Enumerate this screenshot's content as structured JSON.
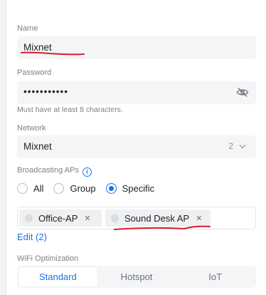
{
  "name": {
    "label": "Name",
    "value": "Mixnet"
  },
  "password": {
    "label": "Password",
    "value": "•••••••••••",
    "help": "Must have at least 8 characters."
  },
  "network": {
    "label": "Network",
    "value": "Mixnet",
    "count": "2"
  },
  "broadcasting": {
    "label": "Broadcasting APs",
    "options": [
      {
        "label": "All",
        "selected": false
      },
      {
        "label": "Group",
        "selected": false
      },
      {
        "label": "Specific",
        "selected": true
      }
    ],
    "chips": [
      "Office-AP",
      "Sound Desk AP"
    ],
    "edit_link": "Edit (2)"
  },
  "wifi_optimization": {
    "label": "WiFi Optimization",
    "options": [
      "Standard",
      "Hotspot",
      "IoT"
    ],
    "active": "Standard"
  },
  "colors": {
    "accent": "#1a73e8",
    "annotation": "#e0192e"
  }
}
